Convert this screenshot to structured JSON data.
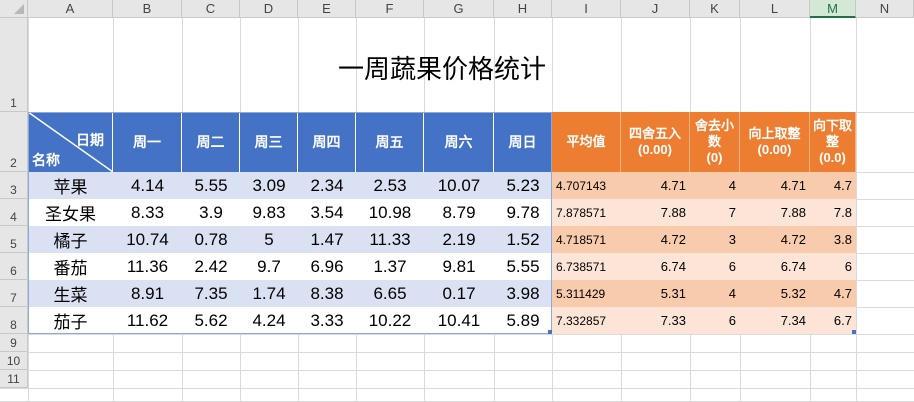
{
  "sheet": {
    "title": "一周蔬果价格统计",
    "columns": [
      "A",
      "B",
      "C",
      "D",
      "E",
      "F",
      "G",
      "H",
      "I",
      "J",
      "K",
      "L",
      "M",
      "N"
    ],
    "selected_column": "M",
    "rows": [
      "1",
      "2",
      "3",
      "4",
      "5",
      "6",
      "7",
      "8",
      "9",
      "10",
      "11"
    ],
    "header": {
      "diag_top": "日期",
      "diag_bottom": "名称",
      "days": [
        "周一",
        "周二",
        "周三",
        "周四",
        "周五",
        "周六",
        "周日"
      ],
      "stats": [
        {
          "line1": "平均值",
          "line2": ""
        },
        {
          "line1": "四舍五入",
          "line2": "(0.00)"
        },
        {
          "line1": "舍去小数",
          "line2": "(0)"
        },
        {
          "line1": "向上取整",
          "line2": "(0.00)"
        },
        {
          "line1": "向下取整",
          "line2": "(0.0)"
        }
      ]
    },
    "data": [
      {
        "name": "苹果",
        "values": [
          "4.14",
          "5.55",
          "3.09",
          "2.34",
          "2.53",
          "10.07",
          "5.23"
        ],
        "avg": "4.707143",
        "round2": "4.71",
        "trunc": "4",
        "ceil": "4.71",
        "floor": "4.7"
      },
      {
        "name": "圣女果",
        "values": [
          "8.33",
          "3.9",
          "9.83",
          "3.54",
          "10.98",
          "8.79",
          "9.78"
        ],
        "avg": "7.878571",
        "round2": "7.88",
        "trunc": "7",
        "ceil": "7.88",
        "floor": "7.8"
      },
      {
        "name": "橘子",
        "values": [
          "10.74",
          "0.78",
          "5",
          "1.47",
          "11.33",
          "2.19",
          "1.52"
        ],
        "avg": "4.718571",
        "round2": "4.72",
        "trunc": "3",
        "ceil": "4.72",
        "floor": "3.8"
      },
      {
        "name": "番茄",
        "values": [
          "11.36",
          "2.42",
          "9.7",
          "6.96",
          "1.37",
          "9.81",
          "5.55"
        ],
        "avg": "6.738571",
        "round2": "6.74",
        "trunc": "6",
        "ceil": "6.74",
        "floor": "6"
      },
      {
        "name": "生菜",
        "values": [
          "8.91",
          "7.35",
          "1.74",
          "8.38",
          "6.65",
          "0.17",
          "3.98"
        ],
        "avg": "5.311429",
        "round2": "5.31",
        "trunc": "4",
        "ceil": "5.32",
        "floor": "4.7"
      },
      {
        "name": "茄子",
        "values": [
          "11.62",
          "5.62",
          "4.24",
          "3.33",
          "10.22",
          "10.41",
          "5.89"
        ],
        "avg": "7.332857",
        "round2": "7.33",
        "trunc": "6",
        "ceil": "7.34",
        "floor": "6.7"
      }
    ]
  }
}
